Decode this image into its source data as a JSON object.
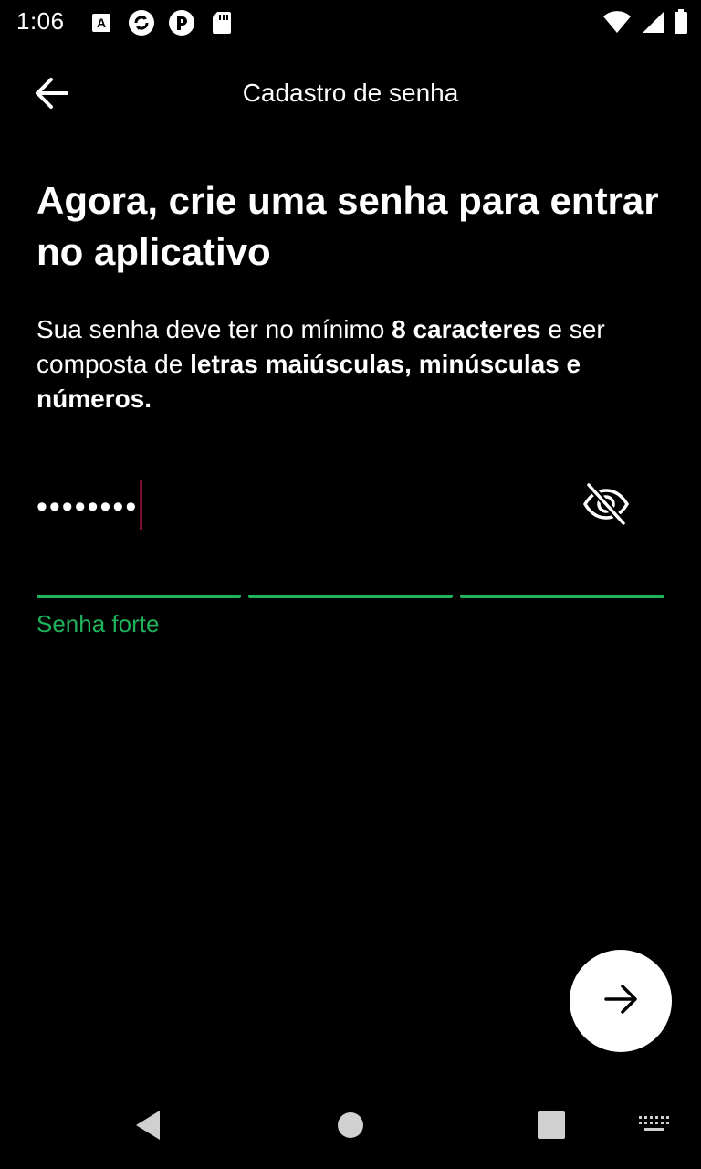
{
  "status_bar": {
    "time": "1:06",
    "left_icons": [
      "notification-a-icon",
      "sync-icon",
      "app-icon",
      "sd-card-icon"
    ],
    "right_icons": [
      "wifi-icon",
      "signal-icon",
      "battery-icon"
    ]
  },
  "header": {
    "title": "Cadastro de senha",
    "back_icon": "arrow-left-icon"
  },
  "main": {
    "heading": "Agora, crie uma senha para entrar no aplicativo",
    "description": {
      "part1": "Sua senha deve ter no mínimo ",
      "bold1": "8 caracteres",
      "part2": " e ser composta de ",
      "bold2": "letras maiúsculas, minúsculas e números."
    },
    "password_field": {
      "value": "••••••••",
      "toggle_icon": "eye-off-icon"
    },
    "strength": {
      "segments_filled": 3,
      "segments_total": 3,
      "label": "Senha forte",
      "color": "#1fb35c"
    }
  },
  "fab": {
    "icon": "arrow-right-icon"
  },
  "nav_bar": {
    "buttons": [
      "back-triangle-icon",
      "home-circle-icon",
      "recents-square-icon",
      "keyboard-icon"
    ]
  }
}
